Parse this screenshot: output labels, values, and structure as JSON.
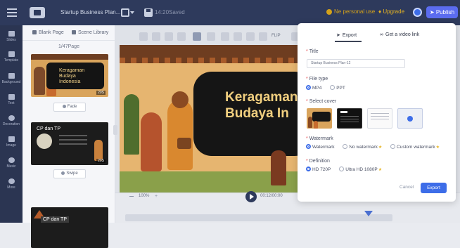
{
  "topbar": {
    "document_title": "Startup Business Plan...",
    "save_time": "14:20Saved",
    "pro_label": "Ne personal use",
    "upgrade_label": "Upgrade",
    "publish_label": "Publish"
  },
  "rail": {
    "items": [
      "Slides",
      "Template",
      "Background",
      "Text",
      "Decoration",
      "Image",
      "Music",
      "More"
    ]
  },
  "page_panel": {
    "tab_blank": "Blank Page",
    "tab_scene": "Scene Library",
    "page_count": "1/47Page",
    "thumb1_title": "Keragaman Budaya Indonesia",
    "thumb1_label": "Fade",
    "thumb2_title": "CP dan TP",
    "thumb2_label": "Swipe",
    "thumb3_title": "CP dan TP",
    "thumb_duration": "20S"
  },
  "canvas": {
    "toolbar_text": "FLIP",
    "slide_title": "Keragaman Budaya In",
    "zoom": "100%",
    "time": "00:12/00:00"
  },
  "modal": {
    "tab_export": "Export",
    "tab_link": "Get a video link",
    "title_label": "Title",
    "title_value": "Startup Business Plan-12",
    "filetype_label": "File type",
    "filetype_options": [
      "MP4",
      "PPT"
    ],
    "cover_label": "Select cover",
    "watermark_label": "Watermark",
    "watermark_options": [
      "Watermark",
      "No watermark",
      "Custom watermark"
    ],
    "definition_label": "Definition",
    "definition_options": [
      "HD 720P",
      "Ultra HD 1080P"
    ],
    "cancel_label": "Cancel",
    "export_label": "Export"
  }
}
